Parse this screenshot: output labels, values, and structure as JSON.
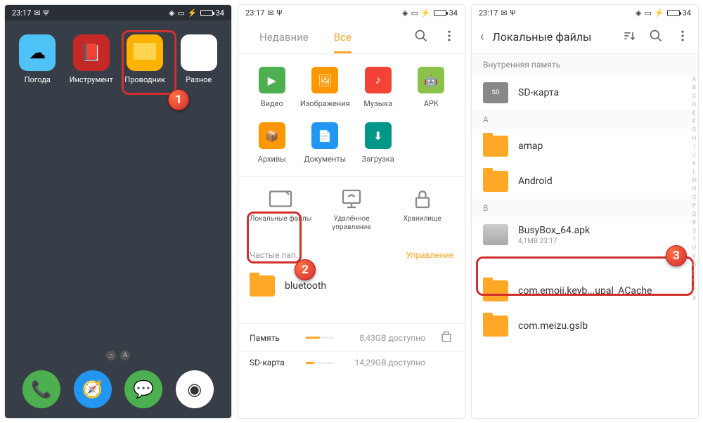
{
  "status": {
    "time": "23:17",
    "battery": "34"
  },
  "phone1": {
    "apps": {
      "weather": "Погода",
      "tools": "Инструмент",
      "explorer": "Проводник",
      "misc": "Разное"
    },
    "indicator_a": "A"
  },
  "phone2": {
    "tabs": {
      "recent": "Недавние",
      "all": "Все"
    },
    "categories": {
      "video": "Видео",
      "images": "Изображения",
      "music": "Музыка",
      "apk": "APK",
      "archives": "Архивы",
      "documents": "Документы",
      "download": "Загрузка"
    },
    "storage": {
      "local": "Локальные файлы",
      "remote": "Удалённое управление",
      "vault": "Хранилище"
    },
    "section": {
      "frequent": "Частые пап...",
      "manage": "Управление"
    },
    "folders": {
      "bluetooth": "bluetooth"
    },
    "memory": {
      "internal_label": "Память",
      "internal_value": "8,43GB доступно",
      "sd_label": "SD-карта",
      "sd_value": "14,29GB доступно"
    }
  },
  "phone3": {
    "title": "Локальные файлы",
    "breadcrumb": "Внутренняя память",
    "sd_card": "SD-карта",
    "sections": {
      "a": "A",
      "b": "B"
    },
    "folders": {
      "amap": "amap",
      "android": "Android",
      "emoji": "com.emoji.keyb...upal_ACache",
      "meizu": "com.meizu.gslb"
    },
    "busybox": {
      "name": "BusyBox_64.apk",
      "meta": "4,1MB  23:17"
    },
    "index": "A\nB\nC\nD\nE\nF\nG\nH\nI\nJ\nK\nL\nM\nN\nO\nP\nQ\nR\nS\nT\nU\nV\nW\nX\nY\nZ\n#"
  },
  "badges": {
    "one": "1",
    "two": "2",
    "three": "3"
  }
}
